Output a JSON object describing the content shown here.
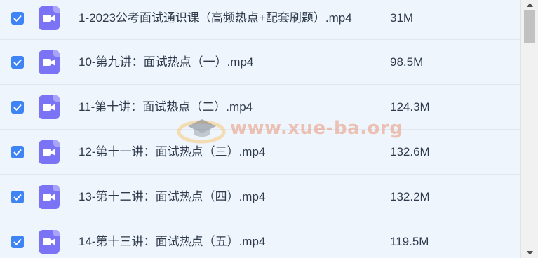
{
  "files": [
    {
      "name": "1-2023公考面试通识课（高频热点+配套刷题）.mp4",
      "size": "31M",
      "checked": true
    },
    {
      "name": "10-第九讲：面试热点（一）.mp4",
      "size": "98.5M",
      "checked": true
    },
    {
      "name": "11-第十讲：面试热点（二）.mp4",
      "size": "124.3M",
      "checked": true
    },
    {
      "name": "12-第十一讲：面试热点（三）.mp4",
      "size": "132.6M",
      "checked": true
    },
    {
      "name": "13-第十二讲：面试热点（四）.mp4",
      "size": "132.2M",
      "checked": true
    },
    {
      "name": "14-第十三讲：面试热点（五）.mp4",
      "size": "119.5M",
      "checked": true
    }
  ],
  "watermark": {
    "text": "www.xue-ba.org"
  },
  "icons": {
    "checkbox": "checkbox-checked-icon",
    "file": "video-file-icon"
  },
  "colors": {
    "accent": "#3e84f5",
    "file_icon": "#7b73f5",
    "background": "#eef5fc"
  }
}
